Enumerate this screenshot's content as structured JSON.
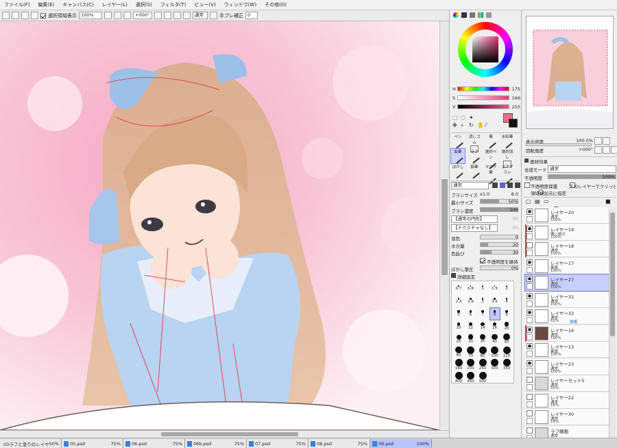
{
  "menu": [
    "ファイル(F)",
    "編集(E)",
    "キャンバス(C)",
    "レイヤー(L)",
    "選択(S)",
    "フィルタ(T)",
    "ビュー(V)",
    "ウィンドウ(W)",
    "その他(O)"
  ],
  "toolbar": {
    "selection_label": "選択領域表示",
    "zoom": "100%",
    "rotation": "+000°",
    "blend": "通常",
    "stabilizer_label": "手ブレ補正",
    "stabilizer_value": "0"
  },
  "color": {
    "h_label": "H",
    "h_value": "175",
    "s_label": "S",
    "s_value": "166",
    "v_label": "V",
    "v_value": "255",
    "primary": "#f06a8c",
    "secondary": "#111111"
  },
  "tools": {
    "row1": [
      "ペン",
      "消しゴム",
      "筆",
      "水彩筆"
    ],
    "row2": [
      "鉛筆",
      "ラフ",
      "選択ペン",
      "選択消し"
    ],
    "row3": [
      "ぼかし",
      "鉛筆",
      "マスク筆",
      "エアブラシ"
    ]
  },
  "brush": {
    "mode": "通常",
    "size_label": "ブラシサイズ",
    "size_mult": "x1.0",
    "size_value": "8.0",
    "min_label": "最小サイズ",
    "min_value": "50%",
    "density_label": "ブラシ濃度",
    "density_value": "100",
    "shape1": "【通常の円形】",
    "shape2": "【テクスチャなし】",
    "shape_val1": "50",
    "shape_val2": "95",
    "mix_label": "混色",
    "mix_value": "0",
    "water_label": "水分量",
    "water_value": "20",
    "blend_label": "色延び",
    "blend_value": "30",
    "keep_opacity_label": "不透明度を維持",
    "blur_label": "ぼかし筆圧",
    "blur_value": "0%",
    "detail_label": "詳細設定",
    "sizes": [
      [
        "0.7",
        "0.8",
        "1",
        "1.5",
        "2"
      ],
      [
        "2.3",
        "2.6",
        "3",
        "3.5",
        "4"
      ],
      [
        "5",
        "6",
        "7",
        "8",
        "9"
      ],
      [
        "10",
        "12",
        "14",
        "16",
        "20"
      ],
      [
        "25",
        "30",
        "35",
        "40",
        "50"
      ],
      [
        "60",
        "70",
        "80",
        "100",
        "120"
      ],
      [
        "160",
        "200",
        "250",
        "300",
        "350"
      ],
      [
        "400",
        "450",
        "500"
      ]
    ]
  },
  "navigator": {
    "zoom_label": "表示倍率",
    "zoom_value": "100.0%",
    "angle_label": "回転角度",
    "angle_value": "+000°"
  },
  "layer_panel": {
    "effects_label": "画材効果",
    "blend_label": "合成モード",
    "blend_value": "通常",
    "opacity_label": "不透明度",
    "opacity_value": "100%",
    "protect_label": "不透明度保護",
    "clip_label": "下のレイヤーでクリッピング",
    "select_src_label": "領域検出元に指定",
    "layers": [
      {
        "name": "レイヤー20",
        "mode": "通常",
        "opacity": "100%",
        "ext": ""
      },
      {
        "name": "レイヤー19",
        "mode": "覆い焼き",
        "opacity": "100%",
        "ext": ""
      },
      {
        "name": "レイヤー18",
        "mode": "通常",
        "opacity": "100%",
        "ext": ""
      },
      {
        "name": "レイヤー17",
        "mode": "乗算",
        "opacity": "100%",
        "ext": ""
      },
      {
        "name": "レイヤー27",
        "mode": "通常",
        "opacity": "100%",
        "ext": ""
      },
      {
        "name": "レイヤー31",
        "mode": "通常",
        "opacity": "100%",
        "ext": ""
      },
      {
        "name": "レイヤー32",
        "mode": "通常",
        "opacity": "62%",
        "ext": "保護"
      },
      {
        "name": "レイヤー16",
        "mode": "通常",
        "opacity": "100%",
        "ext": ""
      },
      {
        "name": "レイヤー13",
        "mode": "乗算",
        "opacity": "100%",
        "ext": ""
      },
      {
        "name": "レイヤー23",
        "mode": "通常",
        "opacity": "100%",
        "ext": ""
      },
      {
        "name": "レイヤーセット5",
        "mode": "通常",
        "opacity": "55%",
        "ext": ""
      },
      {
        "name": "レイヤー22",
        "mode": "通常",
        "opacity": "16%",
        "ext": ""
      },
      {
        "name": "レイヤー30",
        "mode": "通常",
        "opacity": "16%",
        "ext": ""
      },
      {
        "name": "ラフ線画",
        "mode": "通常",
        "opacity": "",
        "ext": ""
      }
    ]
  },
  "tabs": [
    {
      "name": "03ラフと塗りのレイヤ...",
      "zoom": "50%"
    },
    {
      "name": "05.psd",
      "zoom": "75%"
    },
    {
      "name": "06.psd",
      "zoom": "75%"
    },
    {
      "name": "06b.psd",
      "zoom": "75%"
    },
    {
      "name": "07.psd",
      "zoom": "75%"
    },
    {
      "name": "08.psd",
      "zoom": "75%"
    },
    {
      "name": "09.psd",
      "zoom": "100%"
    }
  ]
}
